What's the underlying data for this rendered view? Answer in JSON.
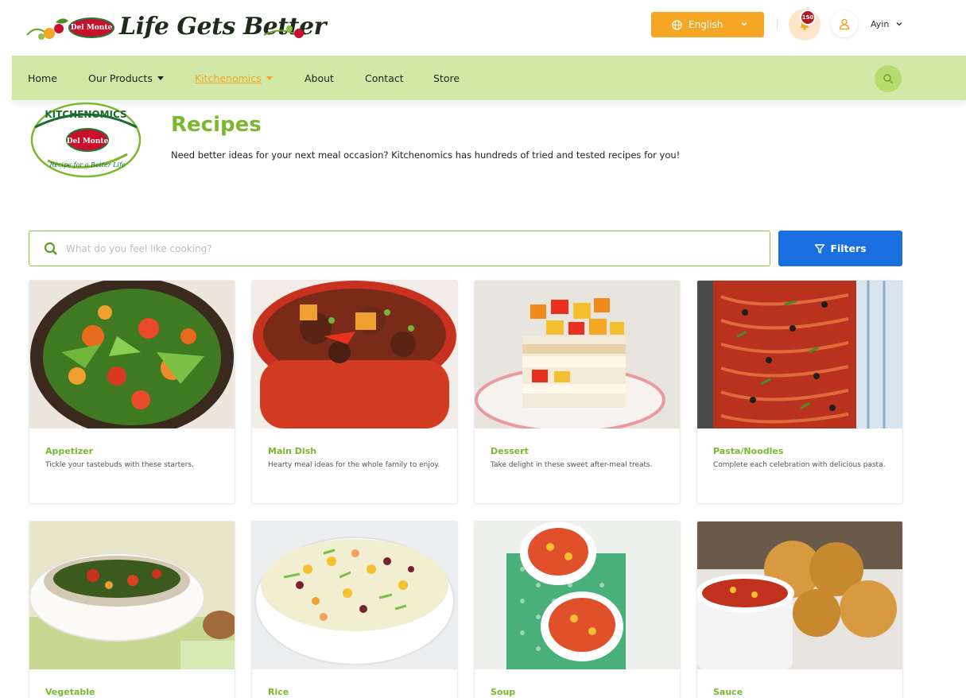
{
  "header": {
    "logo": {
      "tagline": "Life Gets Better",
      "brand": "Del Monte"
    },
    "language": {
      "label": "English",
      "icon": "globe-icon"
    },
    "notifications": {
      "count": "150",
      "icon": "bell-icon"
    },
    "user": {
      "name": "Ayin",
      "icon": "user-icon"
    }
  },
  "nav": {
    "items": [
      {
        "label": "Home",
        "dropdown": false,
        "active": false
      },
      {
        "label": "Our Products",
        "dropdown": true,
        "active": false
      },
      {
        "label": "Kitchenomics",
        "dropdown": true,
        "active": true
      },
      {
        "label": "About",
        "dropdown": false,
        "active": false
      },
      {
        "label": "Contact",
        "dropdown": false,
        "active": false
      },
      {
        "label": "Store",
        "dropdown": false,
        "active": false
      }
    ],
    "search_icon": "search-icon"
  },
  "page": {
    "badge": {
      "top": "KITCHENOMICS",
      "brand": "Del Monte",
      "bottom": "Recipe for a Better Life"
    },
    "title": "Recipes",
    "description": "Need better ideas for your next meal occasion? Kitchenomics has hundreds of tried and tested recipes for you!"
  },
  "search": {
    "placeholder": "What do you feel like cooking?",
    "value": "",
    "filters_label": "Filters"
  },
  "categories": [
    {
      "title": "Appetizer",
      "description": "Tickle your tastebuds with these starters."
    },
    {
      "title": "Main Dish",
      "description": "Hearty meal ideas for the whole family to enjoy."
    },
    {
      "title": "Dessert",
      "description": "Take delight in these sweet after-meal treats."
    },
    {
      "title": "Pasta/Noodles",
      "description": "Complete each celebration with delicious pasta."
    },
    {
      "title": "Vegetable",
      "description": ""
    },
    {
      "title": "Rice",
      "description": ""
    },
    {
      "title": "Soup",
      "description": ""
    },
    {
      "title": "Sauce",
      "description": ""
    }
  ],
  "colors": {
    "accent_green": "#7ab82d",
    "nav_green": "#d2e8a6",
    "orange": "#f5a623",
    "blue": "#1a6fe0"
  }
}
